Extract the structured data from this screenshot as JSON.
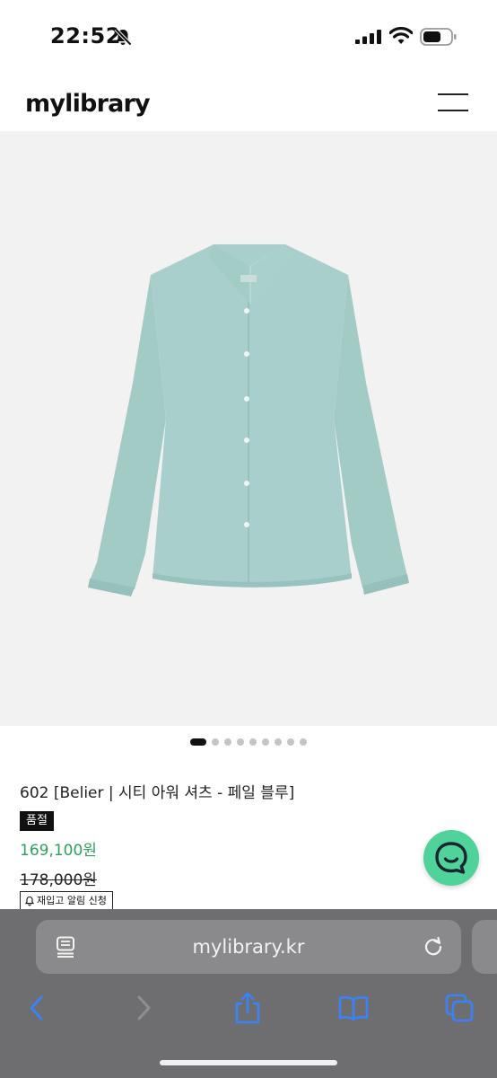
{
  "status_bar": {
    "time": "22:52"
  },
  "header": {
    "logo": "mylibrary"
  },
  "gallery": {
    "slide_count": 9,
    "active_index": 0,
    "background_color": "#f2f2f2",
    "shirt_color": "#a8cfcb"
  },
  "product": {
    "title": "602 [Belier | 시티 아워 셔츠 - 페일 블루]",
    "soldout_badge": "품절",
    "price": "169,100원",
    "original_price": "178,000원",
    "restock_label": "재입고 알림 신청",
    "price_color": "#2fa05a"
  },
  "chat": {
    "color": "#4fd39a"
  },
  "browser": {
    "url": "mylibrary.kr",
    "icons": [
      "reader-icon",
      "reload-icon",
      "back-icon",
      "forward-icon",
      "share-icon",
      "bookmarks-icon",
      "tabs-icon"
    ],
    "accent_color": "#3a82f7"
  }
}
